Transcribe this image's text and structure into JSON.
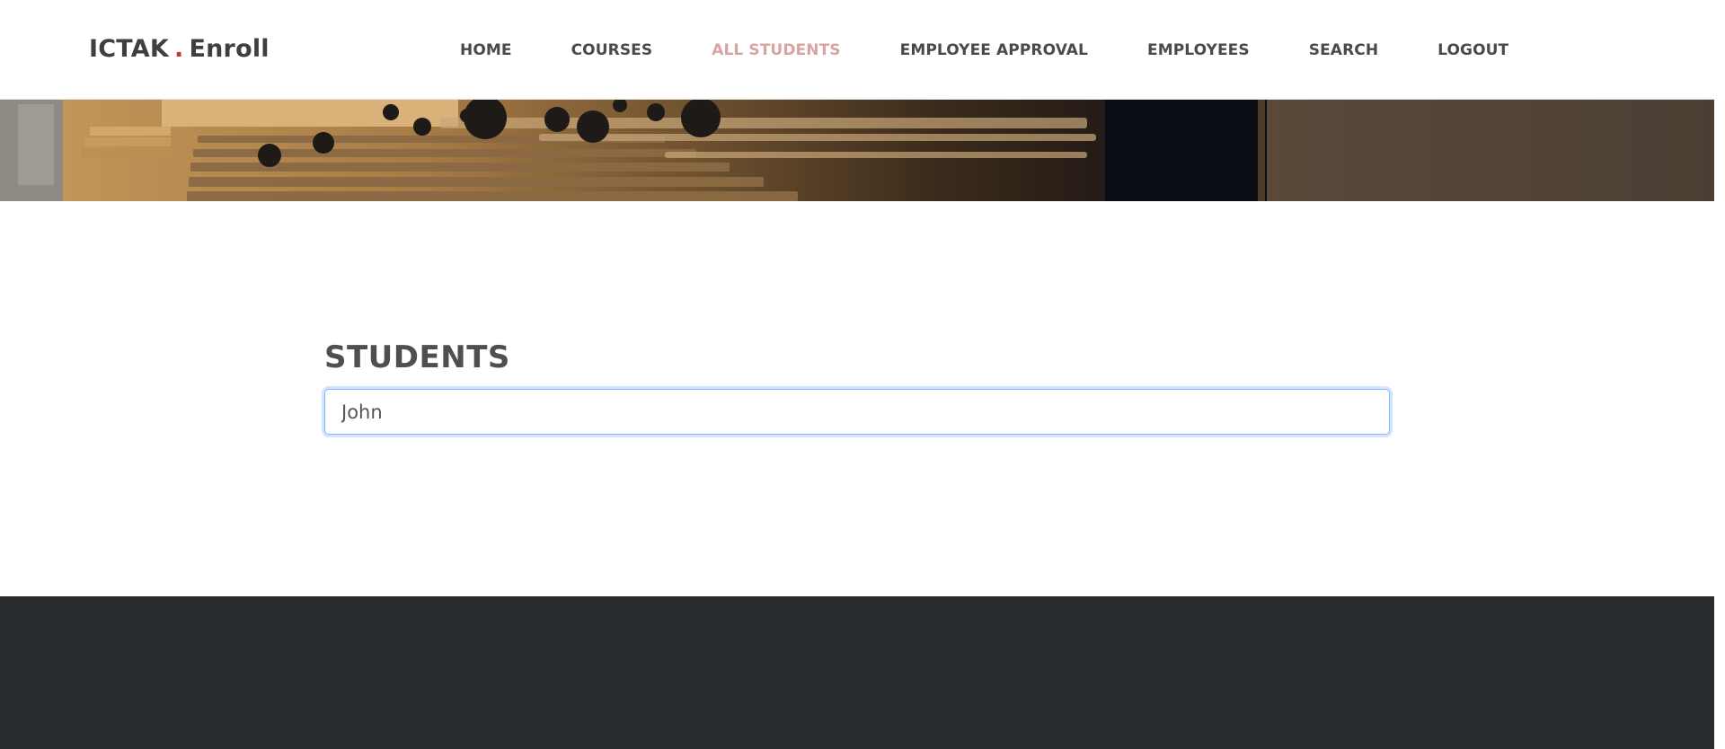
{
  "brand": {
    "name_part1": "ICTAK",
    "dot": ".",
    "name_part2": "Enroll"
  },
  "nav": {
    "items": [
      {
        "label": "HOME",
        "active": false
      },
      {
        "label": "COURSES",
        "active": false
      },
      {
        "label": "ALL STUDENTS",
        "active": true
      },
      {
        "label": "EMPLOYEE APPROVAL",
        "active": false
      },
      {
        "label": "EMPLOYEES",
        "active": false
      },
      {
        "label": "SEARCH",
        "active": false
      },
      {
        "label": "LOGOUT",
        "active": false
      }
    ]
  },
  "main": {
    "title": "STUDENTS",
    "search": {
      "value": "John",
      "placeholder": ""
    }
  },
  "colors": {
    "text_dark": "#4a4a4a",
    "active_nav": "#d7a4a2",
    "brand_dot": "#c0392b",
    "footer_bg": "#292d30",
    "input_focus_border": "#86b7fe"
  }
}
